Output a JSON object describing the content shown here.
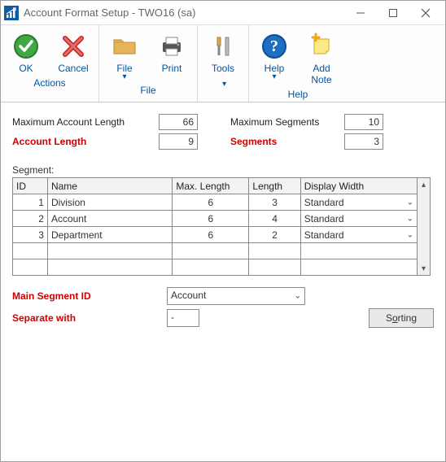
{
  "window": {
    "title": "Account Format Setup  -  TWO16 (sa)"
  },
  "ribbon": {
    "groups": [
      {
        "title": "Actions",
        "buttons": [
          {
            "label": "OK",
            "icon": "check",
            "dropdown": false
          },
          {
            "label": "Cancel",
            "icon": "x-red",
            "dropdown": false
          }
        ]
      },
      {
        "title": "File",
        "buttons": [
          {
            "label": "File",
            "icon": "folder",
            "dropdown": true
          },
          {
            "label": "Print",
            "icon": "printer",
            "dropdown": false
          }
        ]
      },
      {
        "title": "",
        "buttons": [
          {
            "label": "Tools",
            "icon": "tools",
            "dropdown": true
          }
        ]
      },
      {
        "title": "Help",
        "buttons": [
          {
            "label": "Help",
            "icon": "help",
            "dropdown": true
          },
          {
            "label": "Add Note",
            "icon": "note",
            "dropdown": false
          }
        ]
      }
    ]
  },
  "fields": {
    "max_account_length_label": "Maximum Account Length",
    "max_account_length_value": "66",
    "account_length_label": "Account Length",
    "account_length_value": "9",
    "max_segments_label": "Maximum Segments",
    "max_segments_value": "10",
    "segments_label": "Segments",
    "segments_value": "3"
  },
  "segment_section_label": "Segment:",
  "segment_table": {
    "headers": {
      "id": "ID",
      "name": "Name",
      "max": "Max. Length",
      "len": "Length",
      "disp": "Display Width"
    },
    "rows": [
      {
        "id": "1",
        "name": "Division",
        "max": "6",
        "len": "3",
        "disp": "Standard"
      },
      {
        "id": "2",
        "name": "Account",
        "max": "6",
        "len": "4",
        "disp": "Standard"
      },
      {
        "id": "3",
        "name": "Department",
        "max": "6",
        "len": "2",
        "disp": "Standard"
      },
      {
        "id": "",
        "name": "",
        "max": "",
        "len": "",
        "disp": ""
      },
      {
        "id": "",
        "name": "",
        "max": "",
        "len": "",
        "disp": ""
      }
    ]
  },
  "lower": {
    "main_segment_label": "Main Segment ID",
    "main_segment_value": "Account",
    "separate_label": "Separate with",
    "separate_value": "-",
    "sorting_label_prefix": "S",
    "sorting_label_accel": "o",
    "sorting_label_suffix": "rting"
  }
}
